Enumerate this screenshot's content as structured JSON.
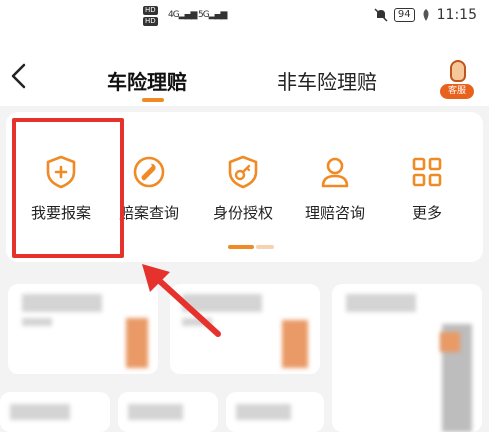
{
  "status_bar": {
    "sim1": "HD",
    "sim2": "HD",
    "signal1": "4G",
    "signal2": "5G",
    "battery": "94",
    "time": "11:15"
  },
  "nav": {
    "back_glyph": "<",
    "tab_active": "车险理赔",
    "tab_inactive": "非车险理赔",
    "service_badge": "客服"
  },
  "quick_actions": [
    {
      "label": "我要报案",
      "icon": "shield-plus-icon"
    },
    {
      "label": "赔案查询",
      "icon": "wrench-icon"
    },
    {
      "label": "身份授权",
      "icon": "shield-key-icon"
    },
    {
      "label": "理赔咨询",
      "icon": "person-icon"
    },
    {
      "label": "更多",
      "icon": "grid-icon"
    }
  ],
  "colors": {
    "accent": "#f08a24",
    "highlight": "#e5322d",
    "background": "#f3f3f3"
  }
}
